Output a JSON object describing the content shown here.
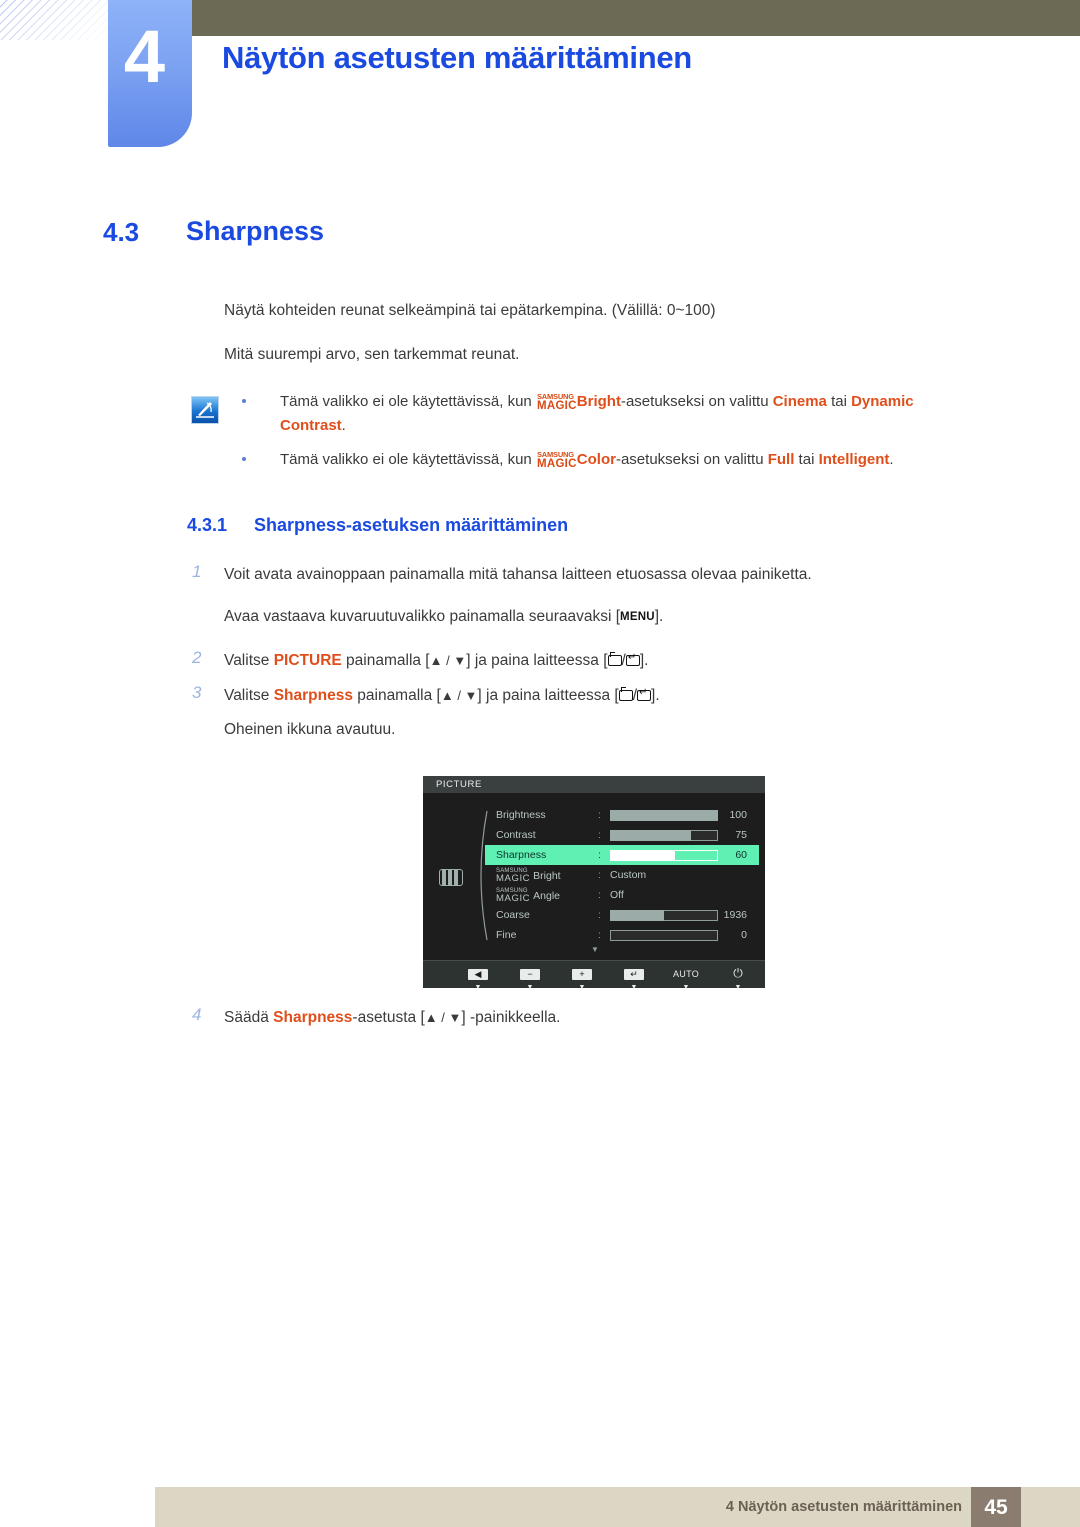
{
  "header": {
    "chapter_number": "4",
    "chapter_title": "Näytön asetusten määrittäminen"
  },
  "section": {
    "number": "4.3",
    "title": "Sharpness",
    "paragraph_1": "Näytä kohteiden reunat selkeämpinä tai epätarkempina. (Välillä: 0~100)",
    "paragraph_2": "Mitä suurempi arvo, sen tarkemmat reunat."
  },
  "note": {
    "icon_name": "note-pen-icon",
    "items": [
      {
        "lead": "Tämä valikko ei ole käytettävissä, kun ",
        "magic_small": "SAMSUNG",
        "magic_large": "MAGIC",
        "mode": "Bright",
        "mid": "-asetukseksi on valittu ",
        "value_1": "Cinema",
        "conj": " tai ",
        "value_2": "Dynamic Contrast",
        "tail": "."
      },
      {
        "lead": "Tämä valikko ei ole käytettävissä, kun ",
        "magic_small": "SAMSUNG",
        "magic_large": "MAGIC",
        "mode": "Color",
        "mid": "-asetukseksi on valittu ",
        "value_1": "Full",
        "conj": " tai ",
        "value_2": "Intelligent",
        "tail": "."
      }
    ]
  },
  "subsection": {
    "number": "4.3.1",
    "title": "Sharpness-asetuksen määrittäminen"
  },
  "steps": {
    "step1_num": "1",
    "step1_text": "Voit avata avainoppaan painamalla mitä tahansa laitteen etuosassa olevaa painiketta.",
    "step1_sub_pre": "Avaa vastaava kuvaruutuvalikko painamalla seuraavaksi [",
    "step1_sub_key": "MENU",
    "step1_sub_post": "].",
    "step2_num": "2",
    "step2_pre": "Valitse ",
    "step2_target": "PICTURE",
    "step2_mid": " painamalla [",
    "step2_keys": "▲ / ▼",
    "step2_mid2": "] ja paina laitteessa [",
    "step2_post": "].",
    "step3_num": "3",
    "step3_pre": "Valitse ",
    "step3_target": "Sharpness",
    "step3_mid": " painamalla [",
    "step3_keys": "▲ / ▼",
    "step3_mid2": "] ja paina laitteessa [",
    "step3_post": "].",
    "step3_sub": "Oheinen ikkuna avautuu.",
    "step4_num": "4",
    "step4_pre": "Säädä ",
    "step4_target": "Sharpness",
    "step4_mid": "-asetusta [",
    "step4_keys": "▲ / ▼",
    "step4_post": "] -painikkeella."
  },
  "osd": {
    "title": "PICTURE",
    "category_icon": "picture-category-icon",
    "scroll_more_icon": "scroll-down-arrow",
    "highlight_color": "#5ff0b4",
    "rows": [
      {
        "label": "Brightness",
        "colon": ":",
        "type": "bar",
        "value": "100",
        "fill_pct": 100,
        "selected": false
      },
      {
        "label": "Contrast",
        "colon": ":",
        "type": "bar",
        "value": "75",
        "fill_pct": 75,
        "selected": false
      },
      {
        "label": "Sharpness",
        "colon": ":",
        "type": "bar",
        "value": "60",
        "fill_pct": 60,
        "selected": true
      },
      {
        "label": "Bright",
        "colon": ":",
        "type": "text",
        "magic_small": "SAMSUNG",
        "magic_large": "MAGIC",
        "value": "Custom",
        "selected": false
      },
      {
        "label": "Angle",
        "colon": ":",
        "type": "text",
        "magic_small": "SAMSUNG",
        "magic_large": "MAGIC",
        "value": "Off",
        "selected": false
      },
      {
        "label": "Coarse",
        "colon": ":",
        "type": "bar",
        "value": "1936",
        "fill_pct": 50,
        "selected": false
      },
      {
        "label": "Fine",
        "colon": ":",
        "type": "bar",
        "value": "0",
        "fill_pct": 0,
        "selected": false
      }
    ],
    "footer_buttons": [
      {
        "icon": "◀",
        "name": "back-button",
        "caret": "▼"
      },
      {
        "icon": "−",
        "name": "minus-button",
        "caret": "▼"
      },
      {
        "icon": "+",
        "name": "plus-button",
        "caret": "▼"
      },
      {
        "icon": "↵",
        "name": "enter-button",
        "caret": "▼"
      },
      {
        "icon": "AUTO",
        "name": "auto-button",
        "caret": "▼"
      },
      {
        "icon": "⏻",
        "name": "power-button",
        "caret": "▼"
      }
    ]
  },
  "footer": {
    "text": "4 Näytön asetusten määrittäminen",
    "page": "45"
  }
}
